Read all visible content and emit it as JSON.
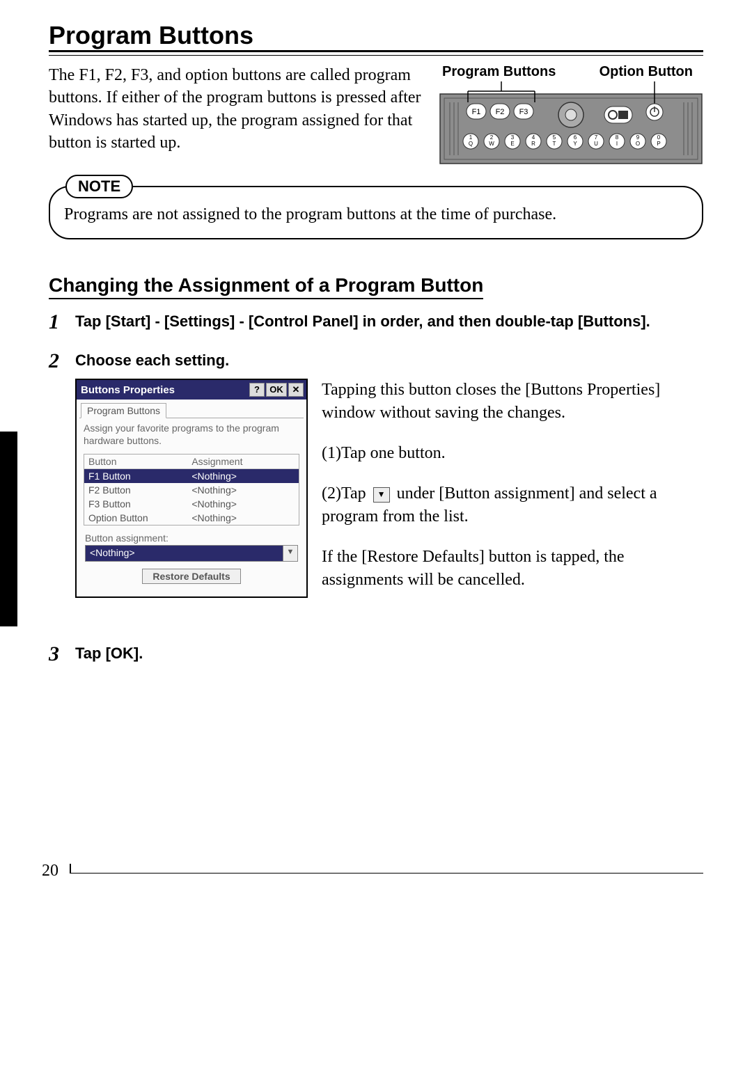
{
  "page_number": "20",
  "title": "Program Buttons",
  "intro": "The F1, F2, F3, and option buttons are called program buttons. If either of the program buttons is pressed after Windows has started up, the program assigned for that button is started up.",
  "figure": {
    "label_program": "Program Buttons",
    "label_option": "Option Button"
  },
  "note": {
    "badge": "NOTE",
    "text": "Programs are not assigned to the program buttons at the time of purchase."
  },
  "section": "Changing the Assignment of a Program Button",
  "steps": {
    "s1": {
      "num": "1",
      "text": "Tap [Start] - [Settings] - [Control Panel] in order, and then double-tap [Buttons]."
    },
    "s2": {
      "num": "2",
      "text": "Choose each setting."
    },
    "s3": {
      "num": "3",
      "text": "Tap [OK]."
    }
  },
  "window": {
    "title": "Buttons Properties",
    "help": "?",
    "ok": "OK",
    "close": "✕",
    "tab": "Program Buttons",
    "desc": "Assign your favorite programs to the program hardware buttons.",
    "head_button": "Button",
    "head_assign": "Assignment",
    "rows": [
      {
        "b": "F1 Button",
        "a": "<Nothing>"
      },
      {
        "b": "F2 Button",
        "a": "<Nothing>"
      },
      {
        "b": "F3 Button",
        "a": "<Nothing>"
      },
      {
        "b": "Option Button",
        "a": "<Nothing>"
      }
    ],
    "label_ba": "Button assignment:",
    "dd_value": "<Nothing>",
    "restore": "Restore Defaults"
  },
  "annotations": {
    "a1": "Tapping this button closes the [Buttons Properties] window without saving the changes.",
    "a2": "(1)Tap one button.",
    "a3_pre": "(2)Tap",
    "a3_post": "under [Button assignment] and select a program from the list.",
    "a4": "If the [Restore Defaults] button is tapped, the assignments will be cancelled."
  }
}
